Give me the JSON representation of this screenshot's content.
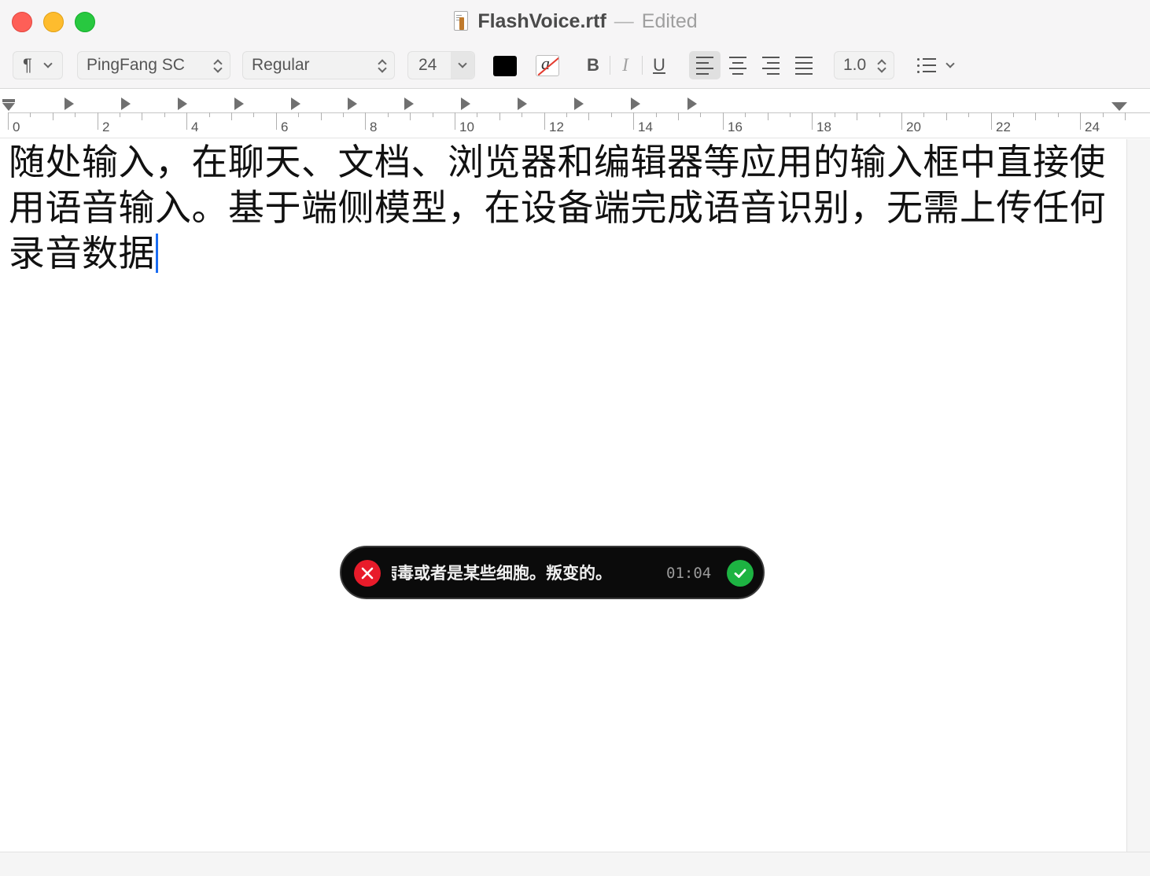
{
  "window": {
    "title": "FlashVoice.rtf",
    "separator": "—",
    "status": "Edited"
  },
  "toolbar": {
    "paragraph_icon": "¶",
    "font_family": "PingFang SC",
    "font_style": "Regular",
    "font_size": "24",
    "text_color": "#000000",
    "bold_label": "B",
    "italic_label": "I",
    "underline_label": "U",
    "alignment": "left",
    "line_spacing": "1.0",
    "list_icon": "bullet-list-icon"
  },
  "ruler": {
    "numbers": [
      "0",
      "2",
      "4",
      "6",
      "8",
      "10",
      "12",
      "14",
      "16",
      "18",
      "20",
      "22",
      "24"
    ]
  },
  "document": {
    "text": "随处输入，在聊天、文档、浏览器和编辑器等应用的输入框中直接使用语音输入。基于端侧模型，在设备端完成语音识别，无需上传任何录音数据"
  },
  "voice_overlay": {
    "transcript": "的病毒或者是某些细胞。叛变的。",
    "elapsed": "01:04",
    "cancel_icon": "close-icon",
    "confirm_icon": "checkmark-icon",
    "cancel_color": "#e81b2a",
    "confirm_color": "#1db342"
  }
}
